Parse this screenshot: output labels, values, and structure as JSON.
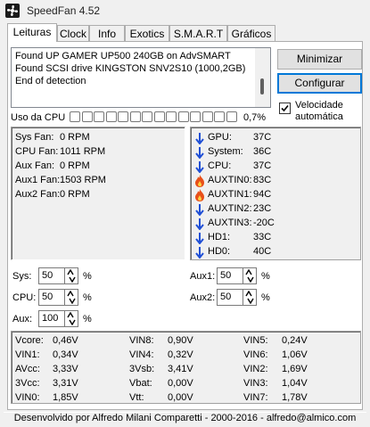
{
  "window": {
    "title": "SpeedFan 4.52"
  },
  "tabs": [
    "Leituras",
    "Clock",
    "Info",
    "Exotics",
    "S.M.A.R.T",
    "Gráficos"
  ],
  "log": {
    "lines": [
      "Found UP GAMER UP500 240GB on AdvSMART",
      "Found SCSI drive KINGSTON SNV2S10 (1000,2GB)",
      "End of detection"
    ]
  },
  "buttons": {
    "minimize": "Minimizar",
    "configure": "Configurar"
  },
  "options": {
    "autospeed_label": "Velocidade automática",
    "autospeed_checked": true
  },
  "cpu_usage": {
    "label": "Uso da CPU",
    "value": "0,7%",
    "fraction": 0.007
  },
  "fans": [
    {
      "label": "Sys Fan:",
      "value": "0 RPM"
    },
    {
      "label": "CPU Fan:",
      "value": "1011 RPM"
    },
    {
      "label": "Aux Fan:",
      "value": "0 RPM"
    },
    {
      "label": "Aux1 Fan:",
      "value": "1503 RPM"
    },
    {
      "label": "Aux2 Fan:",
      "value": "0 RPM"
    }
  ],
  "temps": [
    {
      "label": "GPU:",
      "value": "37C",
      "icon": "arrow-down-icon"
    },
    {
      "label": "System:",
      "value": "36C",
      "icon": "arrow-down-icon"
    },
    {
      "label": "CPU:",
      "value": "37C",
      "icon": "arrow-down-icon"
    },
    {
      "label": "AUXTIN0:",
      "value": "83C",
      "icon": "flame-icon"
    },
    {
      "label": "AUXTIN1:",
      "value": "94C",
      "icon": "flame-icon"
    },
    {
      "label": "AUXTIN2:",
      "value": "23C",
      "icon": "arrow-down-icon"
    },
    {
      "label": "AUXTIN3:",
      "value": "-20C",
      "icon": "arrow-down-icon"
    },
    {
      "label": "HD1:",
      "value": "33C",
      "icon": "arrow-down-icon"
    },
    {
      "label": "HD0:",
      "value": "40C",
      "icon": "arrow-down-icon"
    }
  ],
  "speeds": {
    "sys": {
      "label": "Sys:",
      "value": "50",
      "unit": "%"
    },
    "cpu": {
      "label": "CPU:",
      "value": "50",
      "unit": "%"
    },
    "aux": {
      "label": "Aux:",
      "value": "100",
      "unit": "%"
    },
    "aux1": {
      "label": "Aux1:",
      "value": "50",
      "unit": "%"
    },
    "aux2": {
      "label": "Aux2:",
      "value": "50",
      "unit": "%"
    }
  },
  "voltages": {
    "col1": [
      {
        "label": "Vcore:",
        "value": "0,46V"
      },
      {
        "label": "VIN1:",
        "value": "0,34V"
      },
      {
        "label": "AVcc:",
        "value": "3,33V"
      },
      {
        "label": "3Vcc:",
        "value": "3,31V"
      },
      {
        "label": "VIN0:",
        "value": "1,85V"
      }
    ],
    "col2": [
      {
        "label": "VIN8:",
        "value": "0,90V"
      },
      {
        "label": "VIN4:",
        "value": "0,32V"
      },
      {
        "label": "3Vsb:",
        "value": "3,41V"
      },
      {
        "label": "Vbat:",
        "value": "0,00V"
      },
      {
        "label": "Vtt:",
        "value": "0,00V"
      }
    ],
    "col3": [
      {
        "label": "VIN5:",
        "value": "0,24V"
      },
      {
        "label": "VIN6:",
        "value": "1,06V"
      },
      {
        "label": "VIN2:",
        "value": "1,69V"
      },
      {
        "label": "VIN3:",
        "value": "1,04V"
      },
      {
        "label": "VIN7:",
        "value": "1,78V"
      }
    ]
  },
  "footer": "Desenvolvido por Alfredo Milani Comparetti - 2000-2016 - alfredo@almico.com",
  "colors": {
    "flame": "#e8501a",
    "arrow": "#1f4fd6",
    "focus_border": "#0078d7"
  }
}
